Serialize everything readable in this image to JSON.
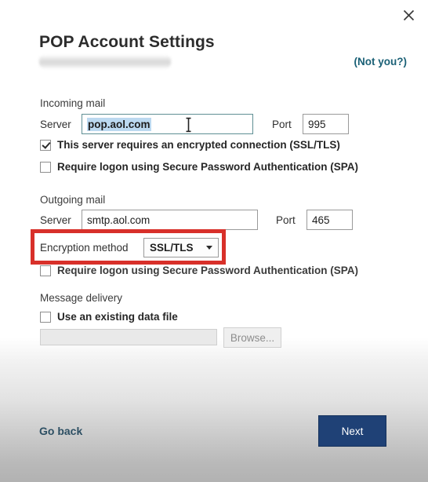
{
  "window": {
    "close_label": "close-icon"
  },
  "header": {
    "title": "POP Account Settings",
    "account_email_redacted": "",
    "not_you_label": "(Not you?)"
  },
  "incoming": {
    "heading": "Incoming mail",
    "server_label": "Server",
    "server_value": "pop.aol.com",
    "server_selected": true,
    "port_label": "Port",
    "port_value": "995",
    "encrypted_checkbox": {
      "label": "This server requires an encrypted connection (SSL/TLS)",
      "checked": true
    },
    "spa_checkbox": {
      "label": "Require logon using Secure Password Authentication (SPA)",
      "checked": false
    }
  },
  "outgoing": {
    "heading": "Outgoing mail",
    "server_label": "Server",
    "server_value": "smtp.aol.com",
    "port_label": "Port",
    "port_value": "465",
    "encryption_label": "Encryption method",
    "encryption_value": "SSL/TLS",
    "encryption_options": [
      "SSL/TLS"
    ],
    "spa_checkbox": {
      "label": "Require logon using Secure Password Authentication (SPA)",
      "checked": false
    }
  },
  "message_delivery": {
    "heading": "Message delivery",
    "use_existing_checkbox": {
      "label": "Use an existing data file",
      "checked": false
    },
    "data_file_value": "",
    "browse_label": "Browse..."
  },
  "footer": {
    "go_back_label": "Go back",
    "next_label": "Next"
  },
  "colors": {
    "accent_link": "#1a6076",
    "primary_button": "#1f4176",
    "annotation": "#d8302a",
    "selection": "#bcd9f0"
  }
}
